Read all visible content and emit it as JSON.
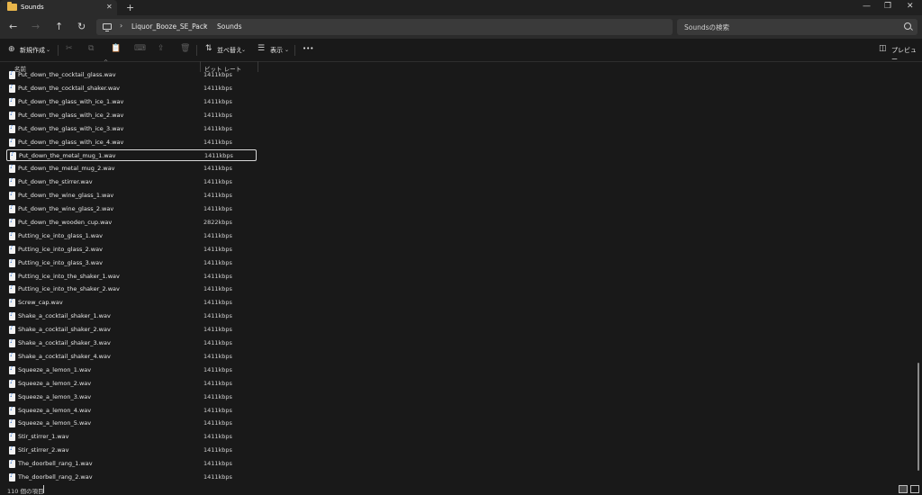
{
  "tab": {
    "title": "Sounds",
    "close": "✕",
    "new_tab": "+"
  },
  "window": {
    "minimize": "—",
    "maximize": "❐",
    "close": "✕"
  },
  "nav": {
    "back": "←",
    "forward": "→",
    "up": "↑",
    "refresh": "↻"
  },
  "address": {
    "separator": "›",
    "crumbs": [
      "Liquor_Booze_SE_Pack",
      "Sounds"
    ]
  },
  "search": {
    "placeholder": "Soundsの検索"
  },
  "command_bar": {
    "new_icon": "⊕",
    "new_label": "新規作成",
    "cut_icon": "✂",
    "copy_icon": "⧉",
    "paste_icon": "📋",
    "rename_icon": "⌨",
    "share_icon": "⇪",
    "delete_icon": "🗑",
    "sort_icon": "⇅",
    "sort_label": "並べ替え",
    "view_icon": "☰",
    "view_label": "表示",
    "more_label": "•••",
    "preview_icon": "◫",
    "preview_label": "プレビュー",
    "chevron": "⌄"
  },
  "columns": {
    "name": "名前",
    "bitrate": "ビット レート",
    "sort_arrow": "^"
  },
  "files": [
    {
      "name": "Put_down_the_cocktail_glass.wav",
      "bitrate": "1411kbps"
    },
    {
      "name": "Put_down_the_cocktail_shaker.wav",
      "bitrate": "1411kbps"
    },
    {
      "name": "Put_down_the_glass_with_ice_1.wav",
      "bitrate": "1411kbps"
    },
    {
      "name": "Put_down_the_glass_with_ice_2.wav",
      "bitrate": "1411kbps"
    },
    {
      "name": "Put_down_the_glass_with_ice_3.wav",
      "bitrate": "1411kbps"
    },
    {
      "name": "Put_down_the_glass_with_ice_4.wav",
      "bitrate": "1411kbps"
    },
    {
      "name": "Put_down_the_metal_mug_1.wav",
      "bitrate": "1411kbps",
      "selected": true
    },
    {
      "name": "Put_down_the_metal_mug_2.wav",
      "bitrate": "1411kbps"
    },
    {
      "name": "Put_down_the_stirrer.wav",
      "bitrate": "1411kbps"
    },
    {
      "name": "Put_down_the_wine_glass_1.wav",
      "bitrate": "1411kbps"
    },
    {
      "name": "Put_down_the_wine_glass_2.wav",
      "bitrate": "1411kbps"
    },
    {
      "name": "Put_down_the_wooden_cup.wav",
      "bitrate": "2822kbps"
    },
    {
      "name": "Putting_ice_into_glass_1.wav",
      "bitrate": "1411kbps"
    },
    {
      "name": "Putting_ice_into_glass_2.wav",
      "bitrate": "1411kbps"
    },
    {
      "name": "Putting_ice_into_glass_3.wav",
      "bitrate": "1411kbps"
    },
    {
      "name": "Putting_ice_into_the_shaker_1.wav",
      "bitrate": "1411kbps"
    },
    {
      "name": "Putting_ice_into_the_shaker_2.wav",
      "bitrate": "1411kbps"
    },
    {
      "name": "Screw_cap.wav",
      "bitrate": "1411kbps"
    },
    {
      "name": "Shake_a_cocktail_shaker_1.wav",
      "bitrate": "1411kbps"
    },
    {
      "name": "Shake_a_cocktail_shaker_2.wav",
      "bitrate": "1411kbps"
    },
    {
      "name": "Shake_a_cocktail_shaker_3.wav",
      "bitrate": "1411kbps"
    },
    {
      "name": "Shake_a_cocktail_shaker_4.wav",
      "bitrate": "1411kbps"
    },
    {
      "name": "Squeeze_a_lemon_1.wav",
      "bitrate": "1411kbps"
    },
    {
      "name": "Squeeze_a_lemon_2.wav",
      "bitrate": "1411kbps"
    },
    {
      "name": "Squeeze_a_lemon_3.wav",
      "bitrate": "1411kbps"
    },
    {
      "name": "Squeeze_a_lemon_4.wav",
      "bitrate": "1411kbps"
    },
    {
      "name": "Squeeze_a_lemon_5.wav",
      "bitrate": "1411kbps"
    },
    {
      "name": "Stir_stirrer_1.wav",
      "bitrate": "1411kbps"
    },
    {
      "name": "Stir_stirrer_2.wav",
      "bitrate": "1411kbps"
    },
    {
      "name": "The_doorbell_rang_1.wav",
      "bitrate": "1411kbps"
    },
    {
      "name": "The_doorbell_rang_2.wav",
      "bitrate": "1411kbps"
    }
  ],
  "status": {
    "item_count": "110 個の項目"
  },
  "colors": {
    "background": "#191919",
    "toolbar": "#2b2b2b",
    "folder": "#e8b54a",
    "audio_icon_note": "#2a6fd1"
  }
}
